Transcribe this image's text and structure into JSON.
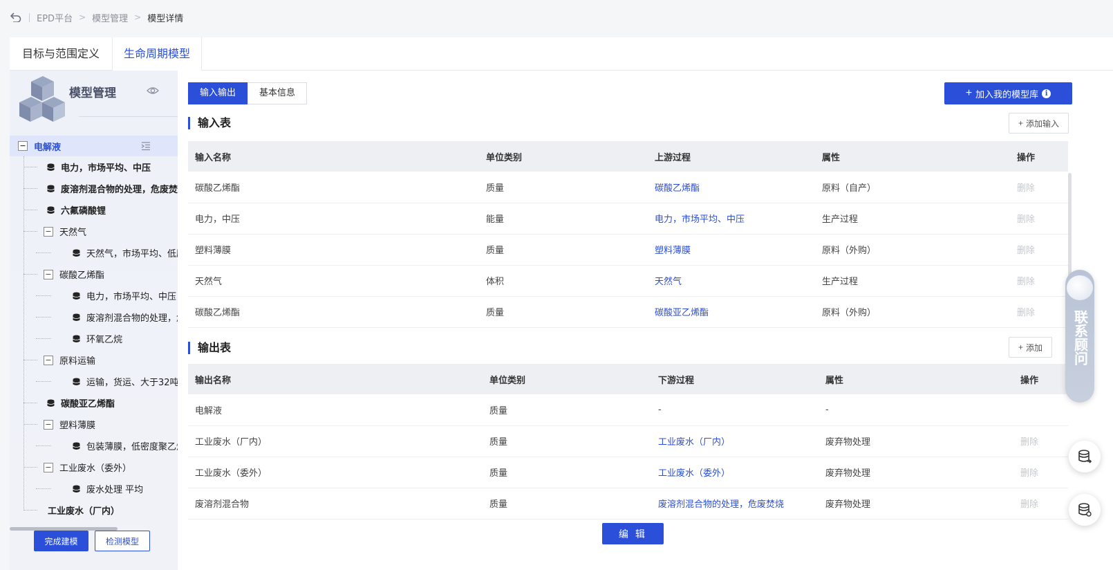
{
  "breadcrumb": [
    "EPD平台",
    "模型管理",
    "模型详情"
  ],
  "top_tabs": [
    "目标与范围定义",
    "生命周期模型"
  ],
  "left_panel": {
    "title": "模型管理",
    "tree": [
      {
        "label": "电解液",
        "kind": "root"
      },
      {
        "label": "电力，市场平均、中压",
        "kind": "db",
        "level": 1,
        "bold": true
      },
      {
        "label": "废溶剂混合物的处理，危废焚烧",
        "kind": "db",
        "level": 1,
        "bold": true
      },
      {
        "label": "六氟磷酸锂",
        "kind": "db",
        "level": 1,
        "bold": true
      },
      {
        "label": "天然气",
        "kind": "folder",
        "level": 1
      },
      {
        "label": "天然气，市场平均、低压",
        "kind": "db",
        "level": 2
      },
      {
        "label": "碳酸乙烯酯",
        "kind": "folder",
        "level": 1
      },
      {
        "label": "电力，市场平均、中压",
        "kind": "db",
        "level": 2
      },
      {
        "label": "废溶剂混合物的处理，危废焚烧",
        "kind": "db",
        "level": 2
      },
      {
        "label": "环氧乙烷",
        "kind": "db",
        "level": 2
      },
      {
        "label": "原料运输",
        "kind": "folder",
        "level": 1
      },
      {
        "label": "运输，货运、大于32吨",
        "kind": "db",
        "level": 2
      },
      {
        "label": "碳酸亚乙烯酯",
        "kind": "db",
        "level": 1,
        "bold": true
      },
      {
        "label": "塑料薄膜",
        "kind": "folder",
        "level": 1
      },
      {
        "label": "包装薄膜，低密度聚乙烯",
        "kind": "db",
        "level": 2
      },
      {
        "label": "工业废水（委外）",
        "kind": "folder",
        "level": 1
      },
      {
        "label": "废水处理 平均",
        "kind": "db",
        "level": 2
      },
      {
        "label": "工业废水（厂内）",
        "kind": "plain",
        "level": 1,
        "bold": true
      }
    ],
    "finish_button": "完成建模",
    "check_button": "检测模型"
  },
  "main": {
    "segments": [
      "输入输出",
      "基本信息"
    ],
    "add_library_button": "加入我的模型库",
    "input_section": {
      "title": "输入表",
      "add_button": "添加输入",
      "columns": [
        "输入名称",
        "单位类别",
        "上游过程",
        "属性",
        "操作"
      ],
      "rows": [
        [
          "碳酸乙烯酯",
          "质量",
          "碳酸乙烯酯",
          "原料（自产）",
          "删除"
        ],
        [
          "电力，中压",
          "能量",
          "电力，市场平均、中压",
          "生产过程",
          "删除"
        ],
        [
          "塑料薄膜",
          "质量",
          "塑料薄膜",
          "原料（外购）",
          "删除"
        ],
        [
          "天然气",
          "体积",
          "天然气",
          "生产过程",
          "删除"
        ],
        [
          "碳酸乙烯酯",
          "质量",
          "碳酸亚乙烯酯",
          "原料（外购）",
          "删除"
        ]
      ]
    },
    "output_section": {
      "title": "输出表",
      "add_button": "添加",
      "columns": [
        "输出名称",
        "单位类别",
        "下游过程",
        "属性",
        "操作"
      ],
      "rows": [
        [
          "电解液",
          "质量",
          "-",
          "-",
          ""
        ],
        [
          "工业废水（厂内）",
          "质量",
          "工业废水（厂内）",
          "废弃物处理",
          "删除"
        ],
        [
          "工业废水（委外）",
          "质量",
          "工业废水（委外）",
          "废弃物处理",
          "删除"
        ],
        [
          "废溶剂混合物",
          "质量",
          "废溶剂混合物的处理，危废焚烧",
          "废弃物处理",
          "删除"
        ]
      ]
    },
    "edit_button": "编 辑"
  },
  "consult_widget": "联系顾问",
  "colors": {
    "primary": "#2b4fd8",
    "tree_selected": "#dfe6fb",
    "header_bg": "#eeeff2"
  }
}
